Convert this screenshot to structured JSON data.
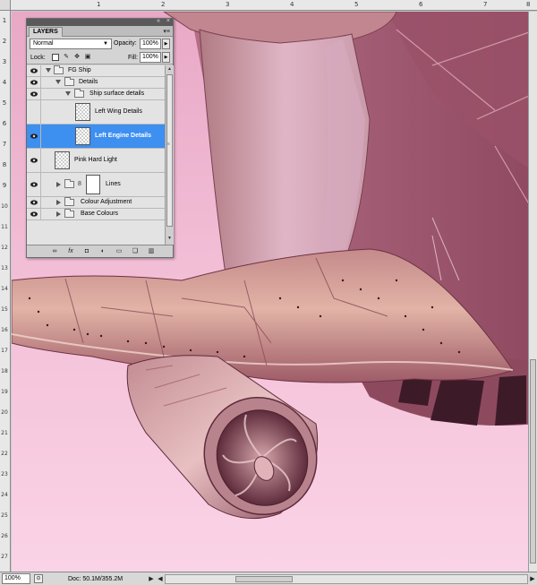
{
  "ruler": {
    "top_labels": [
      "1",
      "2",
      "3",
      "4",
      "5",
      "6",
      "7",
      "8"
    ],
    "left_labels": [
      "1",
      "2",
      "3",
      "4",
      "5",
      "6",
      "7",
      "8",
      "9",
      "10",
      "11",
      "12",
      "13",
      "14",
      "15",
      "16",
      "17",
      "18",
      "19",
      "20",
      "21",
      "22",
      "23",
      "24",
      "25",
      "26",
      "27"
    ]
  },
  "layers_panel": {
    "tab_label": "LAYERS",
    "blend_mode": "Normal",
    "opacity_label": "Opacity:",
    "opacity_value": "100%",
    "lock_label": "Lock:",
    "fill_label": "Fill:",
    "fill_value": "100%",
    "layers": [
      {
        "name": "FG Ship",
        "kind": "group",
        "expanded": true,
        "indent": 0
      },
      {
        "name": "Details",
        "kind": "group",
        "expanded": true,
        "indent": 1
      },
      {
        "name": "Ship surface details",
        "kind": "group",
        "expanded": true,
        "indent": 2
      },
      {
        "name": "Left Wing Details",
        "kind": "layer",
        "indent": 3
      },
      {
        "name": "Left Engine Details",
        "kind": "layer",
        "indent": 3,
        "selected": true
      },
      {
        "name": "Pink Hard Light",
        "kind": "layer",
        "indent": 0
      },
      {
        "name": "Lines",
        "kind": "mask-group",
        "expanded": false,
        "indent": 0
      },
      {
        "name": "Colour Adjustment",
        "kind": "group",
        "expanded": false,
        "indent": 0
      },
      {
        "name": "Base Colours",
        "kind": "group",
        "expanded": false,
        "indent": 0
      }
    ],
    "bottom_icons": [
      "link-icon",
      "fx-icon",
      "mask-icon",
      "adjustment-icon",
      "folder-icon",
      "new-layer-icon",
      "trash-icon"
    ]
  },
  "status": {
    "zoom": "100%",
    "doc_info": "Doc: 50.1M/355.2M"
  },
  "colors": {
    "selection": "#3d8ff0",
    "sky_light": "#f7c4dc",
    "sky_mid": "#e8b0cc",
    "hull": "#a4596f",
    "hull_dark": "#7d3d52",
    "wing": "#c98a8c"
  }
}
